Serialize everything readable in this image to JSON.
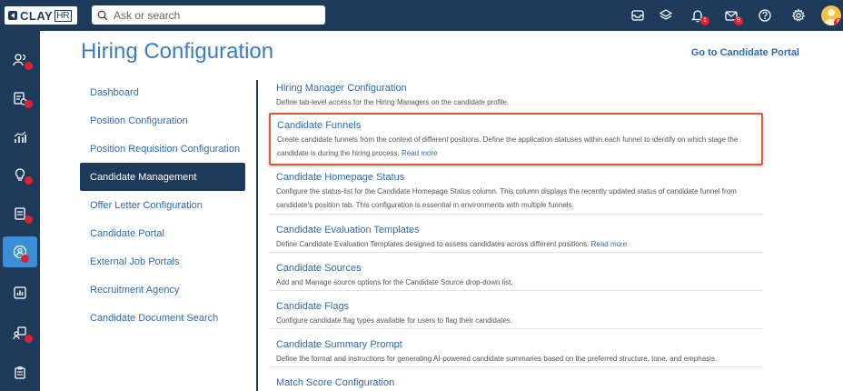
{
  "app": {
    "logo_text": "CLAY",
    "logo_suffix": "HR"
  },
  "search": {
    "placeholder": "Ask or search"
  },
  "topbar": {
    "badges": {
      "notifications": "1",
      "messages": "9",
      "profile": "6"
    }
  },
  "page": {
    "title": "Hiring Configuration",
    "portal_link": "Go to Candidate Portal"
  },
  "subnav": {
    "items": [
      {
        "label": "Dashboard"
      },
      {
        "label": "Position Configuration"
      },
      {
        "label": "Position Requisition Configuration"
      },
      {
        "label": "Candidate Management"
      },
      {
        "label": "Offer Letter Configuration"
      },
      {
        "label": "Candidate Portal"
      },
      {
        "label": "External Job Portals"
      },
      {
        "label": "Recruitment Agency"
      },
      {
        "label": "Candidate Document Search"
      }
    ],
    "active": "Candidate Management"
  },
  "configs": [
    {
      "title": "Hiring Manager Configuration",
      "desc": "Define tab-level access for the Hiring Managers on the candidate profile."
    },
    {
      "title": "Candidate Funnels",
      "desc": "Create candidate funnels from the context of different positions. Define the application statuses within each funnel to identify on which stage the candidate is during the hiring process.",
      "more": "Read more"
    },
    {
      "title": "Candidate Homepage Status",
      "desc": "Configure the status-list for the Candidate Homepage Status column. This column displays the recently updated status of candidate funnel from candidate's position tab. This configuration is essential in environments with multiple funnels."
    },
    {
      "title": "Candidate Evaluation Templates",
      "desc": "Define Candidate Evaluation Templates designed to assess candidates across different positions.",
      "more": "Read more"
    },
    {
      "title": "Candidate Sources",
      "desc": "Add and Manage source options for the Candidate Source drop-down list."
    },
    {
      "title": "Candidate Flags",
      "desc": "Configure candidate flag types available for users to flag their candidates."
    },
    {
      "title": "Candidate Summary Prompt",
      "desc": "Define the format and instructions for generating AI-powered candidate summaries based on the preferred structure, tone, and emphasis."
    },
    {
      "title": "Match Score Configuration",
      "desc": ""
    }
  ],
  "colors": {
    "navy": "#1f3b5c",
    "accent": "#3a8fd6",
    "link": "#2d6cb0",
    "highlight": "#e05a3a",
    "badge": "#e5202e"
  }
}
